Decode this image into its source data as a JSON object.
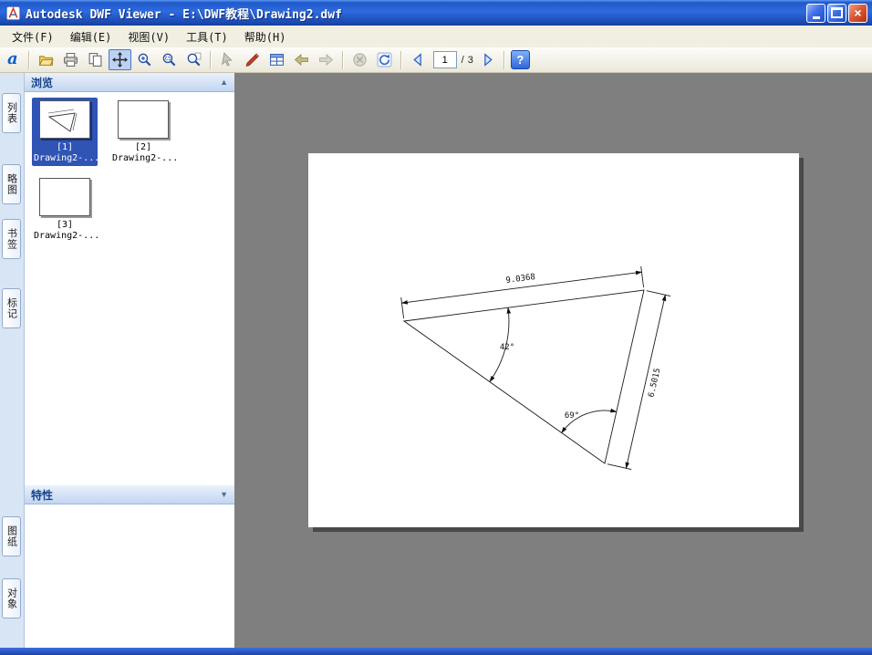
{
  "window": {
    "title": "Autodesk DWF Viewer - E:\\DWF教程\\Drawing2.dwf",
    "controls": {
      "close": "×"
    }
  },
  "menu": {
    "items": [
      {
        "label": "文件(F)"
      },
      {
        "label": "编辑(E)"
      },
      {
        "label": "视图(V)"
      },
      {
        "label": "工具(T)"
      },
      {
        "label": "帮助(H)"
      }
    ]
  },
  "toolbar": {
    "logo": "a",
    "page_current": "1",
    "page_separator": "/",
    "page_total": "3",
    "help_glyph": "?"
  },
  "sidebar": {
    "tabs": [
      {
        "label": "列表"
      },
      {
        "label": "略图"
      },
      {
        "label": "书签"
      },
      {
        "label": "标记"
      },
      {
        "label": "图纸"
      },
      {
        "label": "对象"
      }
    ],
    "browse": {
      "header": "浏览",
      "collapse_glyph": "▲"
    },
    "properties": {
      "header": "特性",
      "collapse_glyph": "▼"
    },
    "thumbnails": [
      {
        "index": "[1]",
        "name": "Drawing2-..."
      },
      {
        "index": "[2]",
        "name": "Drawing2-..."
      },
      {
        "index": "[3]",
        "name": "Drawing2-..."
      }
    ]
  },
  "drawing": {
    "dimensions": {
      "top_length": "9.0368",
      "right_length": "6.5015",
      "angle_left": "42°",
      "angle_bottom": "69°"
    }
  },
  "colors": {
    "titlebar_blue": "#2E6BE0",
    "canvas_gray": "#7F7F7F",
    "selection_blue": "#2F54B4",
    "close_red": "#DC5A38"
  }
}
